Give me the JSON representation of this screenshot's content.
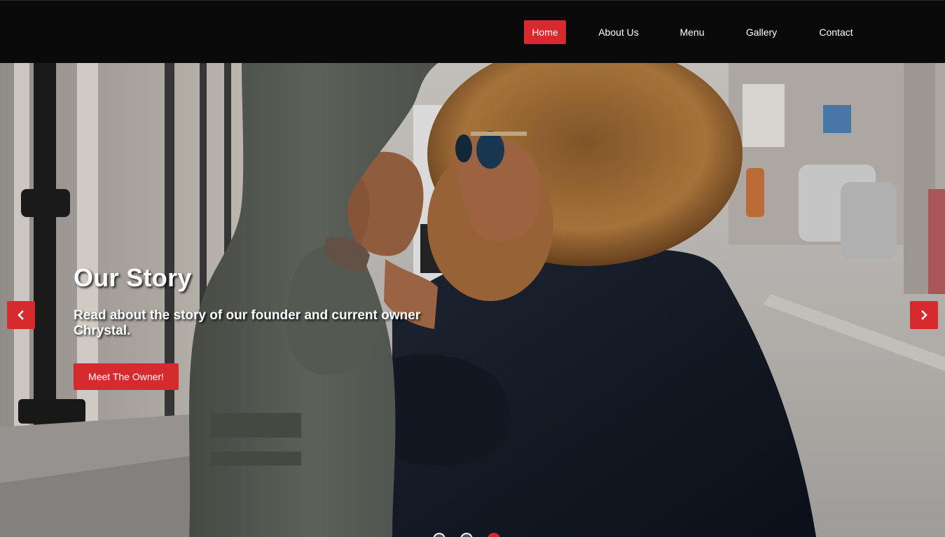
{
  "nav": {
    "items": [
      {
        "label": "Home",
        "active": true
      },
      {
        "label": "About Us",
        "active": false
      },
      {
        "label": "Menu",
        "active": false
      },
      {
        "label": "Gallery",
        "active": false
      },
      {
        "label": "Contact",
        "active": false
      }
    ]
  },
  "hero": {
    "title": "Our Story",
    "text": "Read about the story of our founder and current owner Chrystal.",
    "button_label": "Meet The Owner!",
    "prev_icon": "chevron-left-icon",
    "next_icon": "chevron-right-icon",
    "slides_total": 3,
    "active_slide": 3
  },
  "colors": {
    "accent": "#d62a2f",
    "navbar_bg": "#0a0a0a"
  }
}
